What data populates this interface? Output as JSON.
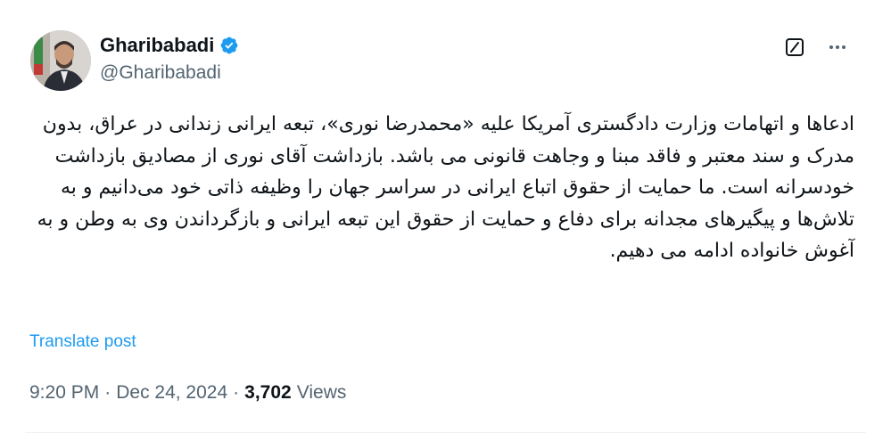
{
  "author": {
    "display_name": "Gharibabadi",
    "handle": "@Gharibabadi",
    "verified": true,
    "avatar_icon": "user-photo"
  },
  "post": {
    "text": "ادعاها و اتهامات وزارت دادگستری آمریکا علیه «محمدرضا نوری»، تبعه ایرانی زندانی در عراق، بدون مدرک و سند معتبر و فاقد مبنا و وجاهت قانونی می باشد. بازداشت آقای نوری از مصادیق بازداشت خودسرانه است. ما حمایت از حقوق اتباع ایرانی در سراسر جهان را وظیفه ذاتی خود می‌دانیم و به تلاش‌ها و پیگیرهای مجدانه برای دفاع و حمایت از حقوق این تبعه ایرانی و بازگرداندن وی به وطن و به آغوش خانواده ادامه می دهیم.",
    "translate_label": "Translate post",
    "time": "9:20 PM",
    "separator": "·",
    "date": "Dec 24, 2024",
    "views_count": "3,702",
    "views_label": "Views"
  },
  "actions": {
    "grok_icon": "grok-slash-icon",
    "more_icon": "more-dots-icon"
  },
  "colors": {
    "accent": "#1d9bf0",
    "muted": "#536471",
    "text": "#0f1419"
  }
}
